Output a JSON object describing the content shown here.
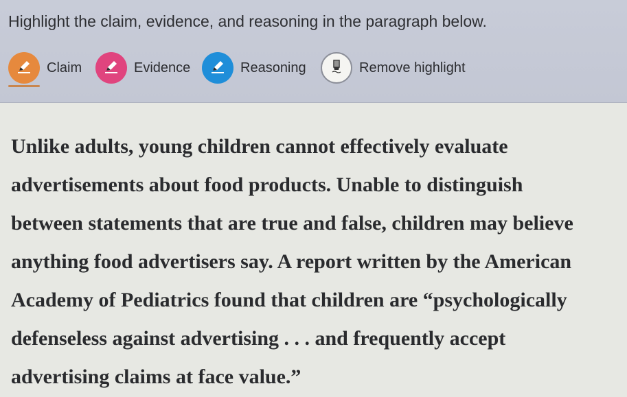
{
  "instruction": "Highlight the claim, evidence, and reasoning in the paragraph below.",
  "tools": [
    {
      "label": "Claim",
      "color": "#e6893d",
      "icon": "pencil-icon",
      "selected": true
    },
    {
      "label": "Evidence",
      "color": "#e0447e",
      "icon": "pencil-icon"
    },
    {
      "label": "Reasoning",
      "color": "#1f8ed9",
      "icon": "pencil-icon"
    },
    {
      "label": "Remove highlight",
      "icon": "eraser-icon"
    }
  ],
  "passage": {
    "lines": [
      "Unlike adults, young children cannot effectively evaluate",
      "advertisements about food products. Unable to distinguish",
      "between statements that are true and false, children may believe",
      "anything food advertisers say. A report written by the American",
      "Academy of Pediatrics found that children are “psychologically",
      "defenseless against advertising . . . and frequently accept",
      "advertising claims at face value.”"
    ]
  },
  "colors": {
    "toolbar_bg": "#c5c9d6",
    "page_bg": "#e7e8e3",
    "claim": "#e6893d",
    "evidence": "#e0447e",
    "reasoning": "#1f8ed9"
  }
}
